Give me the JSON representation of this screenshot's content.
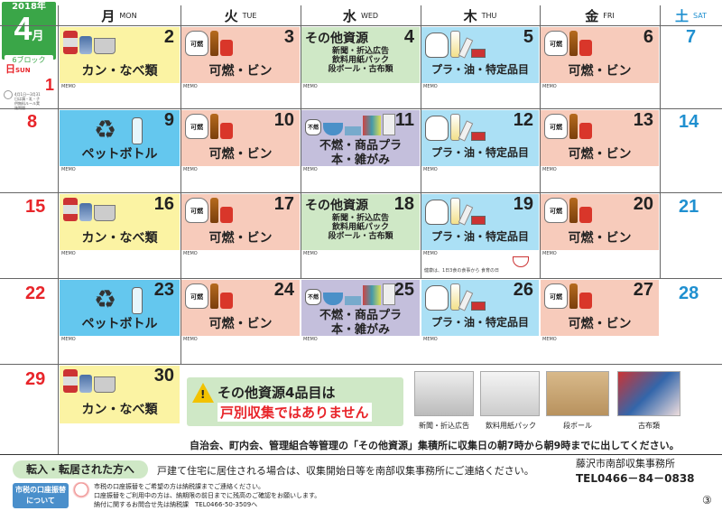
{
  "header": {
    "year": "2018年",
    "month": "4",
    "month_unit": "月",
    "block": "6ブロック",
    "days": [
      {
        "jp": "月",
        "en": "MON"
      },
      {
        "jp": "火",
        "en": "TUE"
      },
      {
        "jp": "水",
        "en": "WED"
      },
      {
        "jp": "木",
        "en": "THU"
      },
      {
        "jp": "金",
        "en": "FRI"
      },
      {
        "jp": "土",
        "en": "SAT"
      },
      {
        "jp": "日",
        "en": "SUN"
      }
    ]
  },
  "labels": {
    "memo": "MEMO",
    "kanen_bin": "可燃・ビン",
    "kan_nabe": "カン・なべ類",
    "pet": "ペットボトル",
    "pura": "プラ・油・特定品目",
    "other_title": "その他資源",
    "other_lines": [
      "新聞・折込広告",
      "飲料用紙パック",
      "段ボール・古布類"
    ],
    "funen_line1": "不燃・商品プラ",
    "funen_line2": "本・雑がみ",
    "kanen_tag": "可燃",
    "funen_tag": "不燃"
  },
  "sun_note": "4月1日～3月31日は鶏・乳・子供無料ルール実施期間",
  "health_note": "健康は、1日3食の食事から 食育の日",
  "weeks": [
    {
      "sun": "1",
      "mon": "2",
      "tue": "3",
      "wed": "4",
      "thu": "5",
      "fri": "6",
      "sat": "7"
    },
    {
      "sun": "8",
      "mon": "9",
      "tue": "10",
      "wed": "11",
      "thu": "12",
      "fri": "13",
      "sat": "14"
    },
    {
      "sun": "15",
      "mon": "16",
      "tue": "17",
      "wed": "18",
      "thu": "19",
      "fri": "20",
      "sat": "21"
    },
    {
      "sun": "22",
      "mon": "23",
      "tue": "24",
      "wed": "25",
      "thu": "26",
      "fri": "27",
      "sat": "28"
    },
    {
      "sun": "29",
      "mon": "30"
    }
  ],
  "notice": {
    "line1": "その他資源4品目は",
    "line2": "戸別収集ではありません",
    "photos": [
      "新聞・折込広告",
      "飲料用紙パック",
      "段ボール",
      "古布類"
    ],
    "bottom": "自治会、町内会、管理組合等管理の「その他資源」集積所に収集日の朝7時から朝9時までに出してください。"
  },
  "footer": {
    "move_title": "転入・転居された方へ",
    "move_text": "戸建て住宅に居住される場合は、収集開始日等を南部収集事務所にご連絡ください。",
    "office_name": "藤沢市南部収集事務所",
    "office_tel": "TEL0466－84－0838",
    "tax_title_1": "市税の口座振替",
    "tax_title_2": "について",
    "tax_lines": [
      "市税の口座振替をご希望の方は納税課までご連絡ください。",
      "口座振替をご利用中の方は、納期限の前日までに残高のご確認をお願いします。",
      "納付に関するお問合せ先は納税課　TEL0466-50-3509へ"
    ],
    "page": "③"
  },
  "colors": {
    "yellow": "#fbf3a3",
    "pink": "#f7cbbb",
    "green": "#cfe8c6",
    "blue": "#64c7ee",
    "purple": "#c4bfdc",
    "sky": "#abe0f5",
    "sun_red": "#e8252a",
    "sat_blue": "#2090d0",
    "month_green": "#3aa648"
  }
}
